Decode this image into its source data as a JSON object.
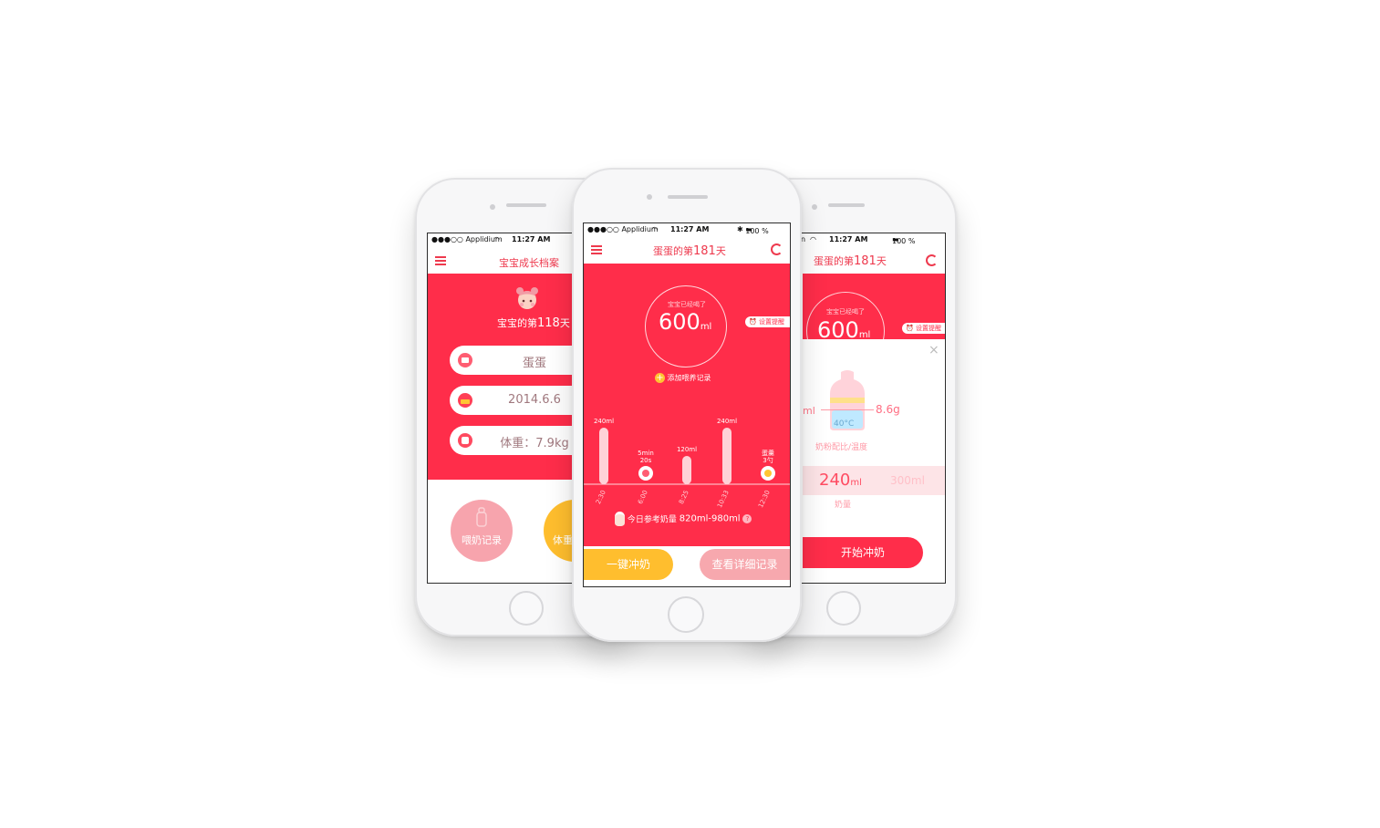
{
  "screens": {
    "left": {
      "status": {
        "carrier": "●●●○○ Applidium",
        "time": "11:27 AM"
      },
      "nav_title": "宝宝成长档案",
      "days_prefix": "宝宝的第",
      "days_number": "118",
      "days_suffix": "天",
      "fields": [
        {
          "icon": "name-card-icon",
          "value": "蛋蛋"
        },
        {
          "icon": "birthday-cake-icon",
          "value": "2014.6.6"
        },
        {
          "icon": "scale-icon",
          "value": "体重：7.9kg"
        }
      ],
      "feeding_button": "喂奶记录",
      "weight_button": "体重"
    },
    "center": {
      "status": {
        "carrier": "●●●○○ Applidium",
        "time": "11:27 AM",
        "battery": "100 %"
      },
      "nav_prefix": "蛋蛋的第",
      "nav_number": "181",
      "nav_suffix": "天",
      "gauge_caption": "宝宝已经喝了",
      "gauge_value": "600",
      "gauge_unit": "ml",
      "reminder_label": "设置提醒",
      "add_record_label": "添加喂养记录",
      "reference_prefix": "今日参考奶量",
      "reference_value": "820ml-980ml",
      "quick_feed_button": "一键冲奶",
      "detail_button": "查看详细记录"
    },
    "right": {
      "status": {
        "carrier": "n",
        "time": "11:27 AM",
        "battery": "100 %"
      },
      "nav_prefix": "蛋蛋的第",
      "nav_number": "181",
      "nav_suffix": "天",
      "gauge_caption": "宝宝已经喝了",
      "gauge_value": "600",
      "gauge_unit": "ml",
      "reminder_label": "设置提醒",
      "left_amount": "ml",
      "powder_amount": "8.6g",
      "temperature": "40°C",
      "ratio_label": "奶粉配比/温度",
      "amount_selected": "240",
      "amount_selected_unit": "ml",
      "amount_next": "300ml",
      "amount_label": "奶量",
      "start_button": "开始冲奶"
    }
  },
  "chart_data": {
    "type": "bar",
    "categories": [
      "2:30",
      "6:00",
      "8:25",
      "10:33",
      "12:30"
    ],
    "values": [
      240,
      null,
      120,
      240,
      null
    ],
    "bar_labels": [
      "240ml",
      "5min 20s",
      "120ml",
      "240ml",
      "蛋羹 3勺"
    ],
    "marker_types": [
      "bottle",
      "breastfeeding",
      "bottle",
      "bottle",
      "solid-food"
    ],
    "ylim": [
      0,
      240
    ]
  },
  "colors": {
    "accent_red": "#ff2d4a",
    "yellow": "#ffbe2e",
    "pink_button": "#f7a8ae",
    "pale_pink_bar": "#ffd1d7"
  }
}
